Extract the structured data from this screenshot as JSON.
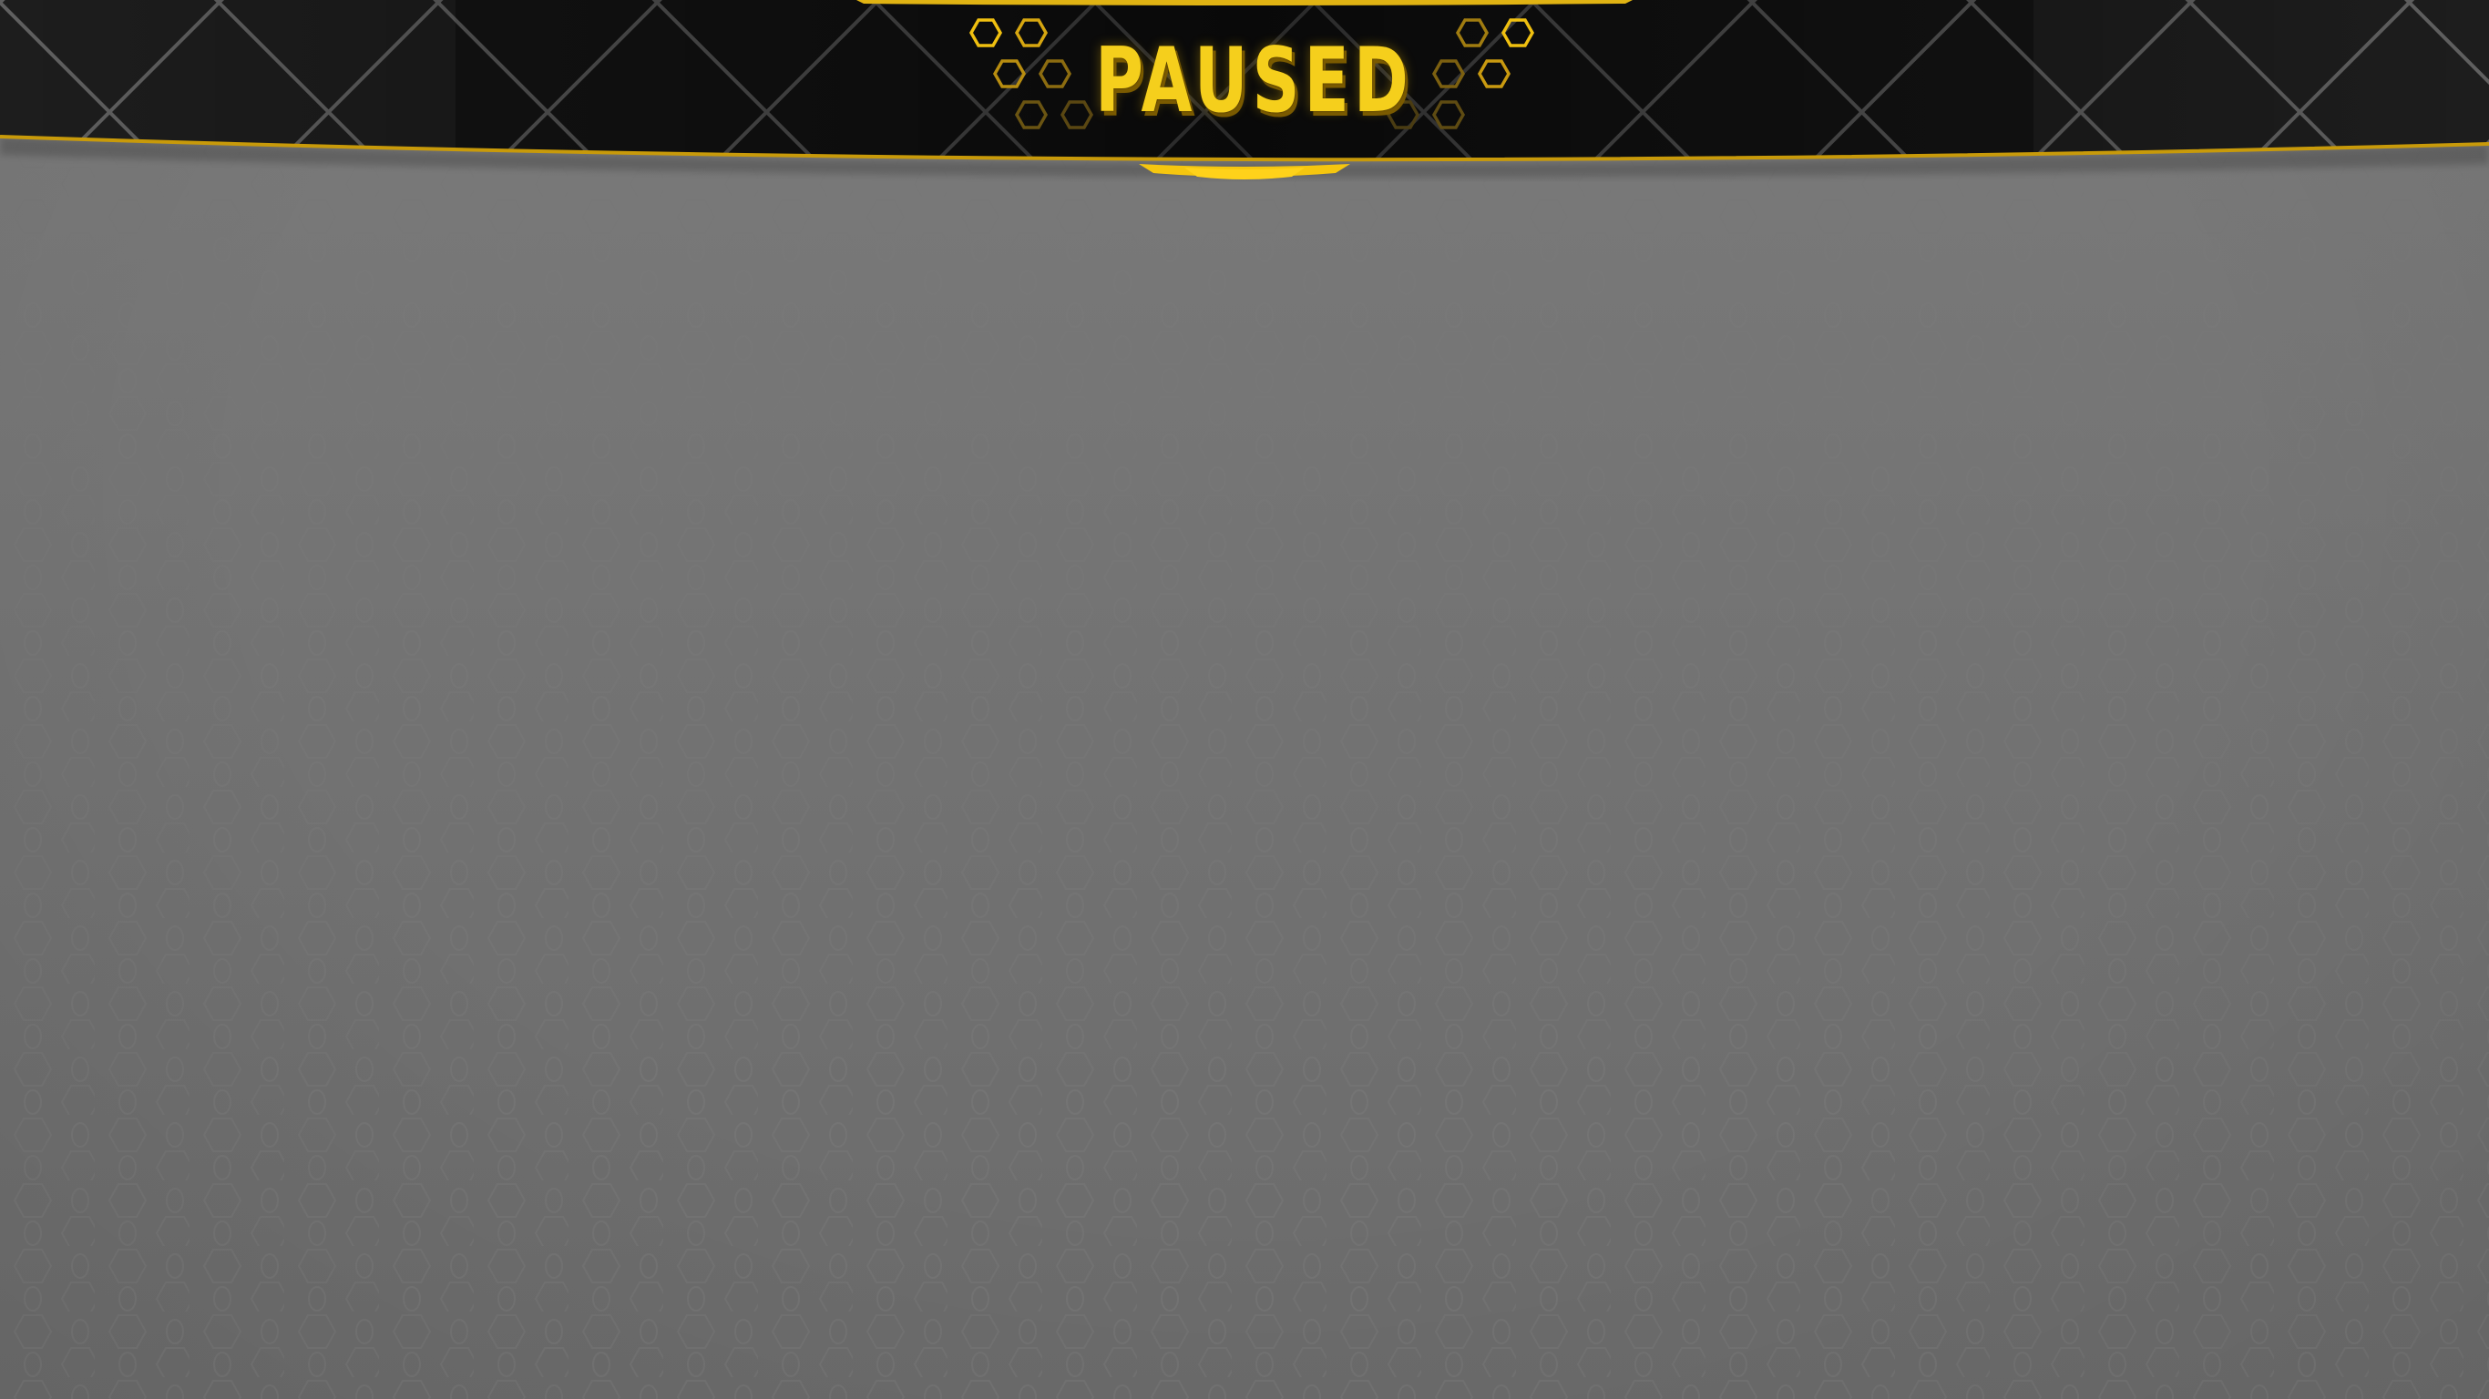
{
  "screen": {
    "state_title": "PAUSED"
  },
  "colors": {
    "accent_gold": "#f5cf1c",
    "banner_dark": "#161616",
    "overlay_grey": "#6e6e6e"
  },
  "icons": {
    "left_decoration": "honeycomb-cluster-icon",
    "right_decoration": "honeycomb-cluster-icon"
  }
}
